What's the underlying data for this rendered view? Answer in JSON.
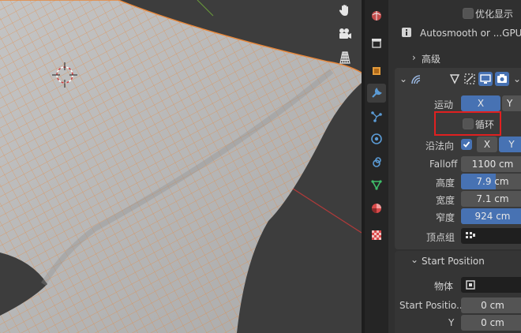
{
  "viewport": {
    "tools": [
      "hand-icon",
      "camera-icon",
      "grid-icon"
    ],
    "colors": {
      "mesh": "#b8b8b8",
      "wire": "#e8873a",
      "background": "#3d3d3d",
      "axis_x": "#b03a3a",
      "axis_y": "#6a9a3a"
    }
  },
  "tabs": [
    "world-icon",
    "collection-icon",
    "object-icon",
    "modifier-icon",
    "particles-icon",
    "physics-icon",
    "constraints-icon",
    "data-icon",
    "material-icon",
    "texture-icon"
  ],
  "properties": {
    "top": {
      "optimize_display_label": "优化显示",
      "info_text": "Autosmooth or ...GPU su",
      "advanced_label": "高级"
    },
    "modifier": {
      "motion_label": "运动",
      "motion_x": "X",
      "motion_y": "Y",
      "cyclic_label": "循环",
      "along_normal_label": "沿法向",
      "along_normal_x": "X",
      "along_normal_y": "Y",
      "falloff_label": "Falloff",
      "falloff_value": "1100 cm",
      "height_label": "高度",
      "height_value": "7.9 cm",
      "height_fill": 0.55,
      "width_label": "宽度",
      "width_value": "7.1 cm",
      "narrowness_label": "窄度",
      "narrowness_value": "924 cm",
      "narrowness_fill": 1.0,
      "vertex_group_label": "顶点组"
    },
    "start_position": {
      "header": "Start Position",
      "object_label": "物体",
      "start_x_label": "Start Positio...",
      "start_x_value": "0 cm",
      "y_label": "Y",
      "y_value": "0 cm"
    },
    "accent_color": "#4772b3",
    "highlight_color": "#e02020"
  }
}
